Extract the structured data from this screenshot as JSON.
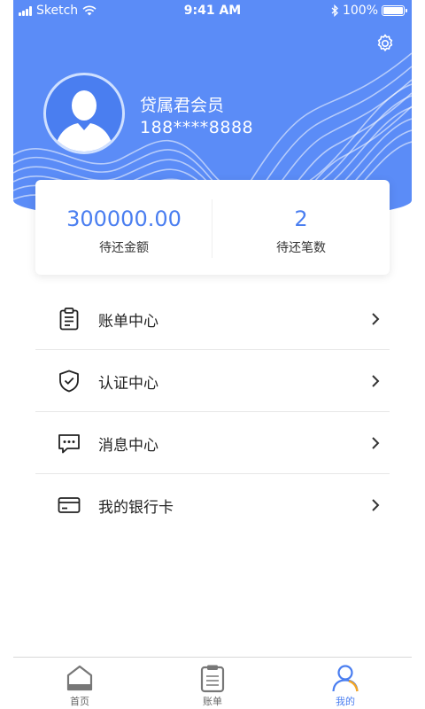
{
  "status_bar": {
    "carrier": "Sketch",
    "time": "9:41 AM",
    "battery": "100%",
    "battery_level": 1.0
  },
  "profile": {
    "name": "贷属君会员",
    "phone": "188****8888"
  },
  "summary": {
    "amount_value": "300000.00",
    "amount_label": "待还金额",
    "count_value": "2",
    "count_label": "待还笔数"
  },
  "menu": {
    "items": [
      {
        "label": "账单中心",
        "icon": "clipboard-icon"
      },
      {
        "label": "认证中心",
        "icon": "shield-check-icon"
      },
      {
        "label": "消息中心",
        "icon": "message-icon"
      },
      {
        "label": "我的银行卡",
        "icon": "bank-card-icon"
      }
    ]
  },
  "tabbar": {
    "tabs": [
      {
        "label": "首页",
        "icon": "home-icon"
      },
      {
        "label": "账单",
        "icon": "bill-icon"
      },
      {
        "label": "我的",
        "icon": "user-icon"
      }
    ],
    "active": "我的"
  },
  "colors": {
    "primary": "#5b8cf7",
    "accent": "#4a7ef0",
    "tab_accent": "#f5a623",
    "text": "#222222"
  }
}
